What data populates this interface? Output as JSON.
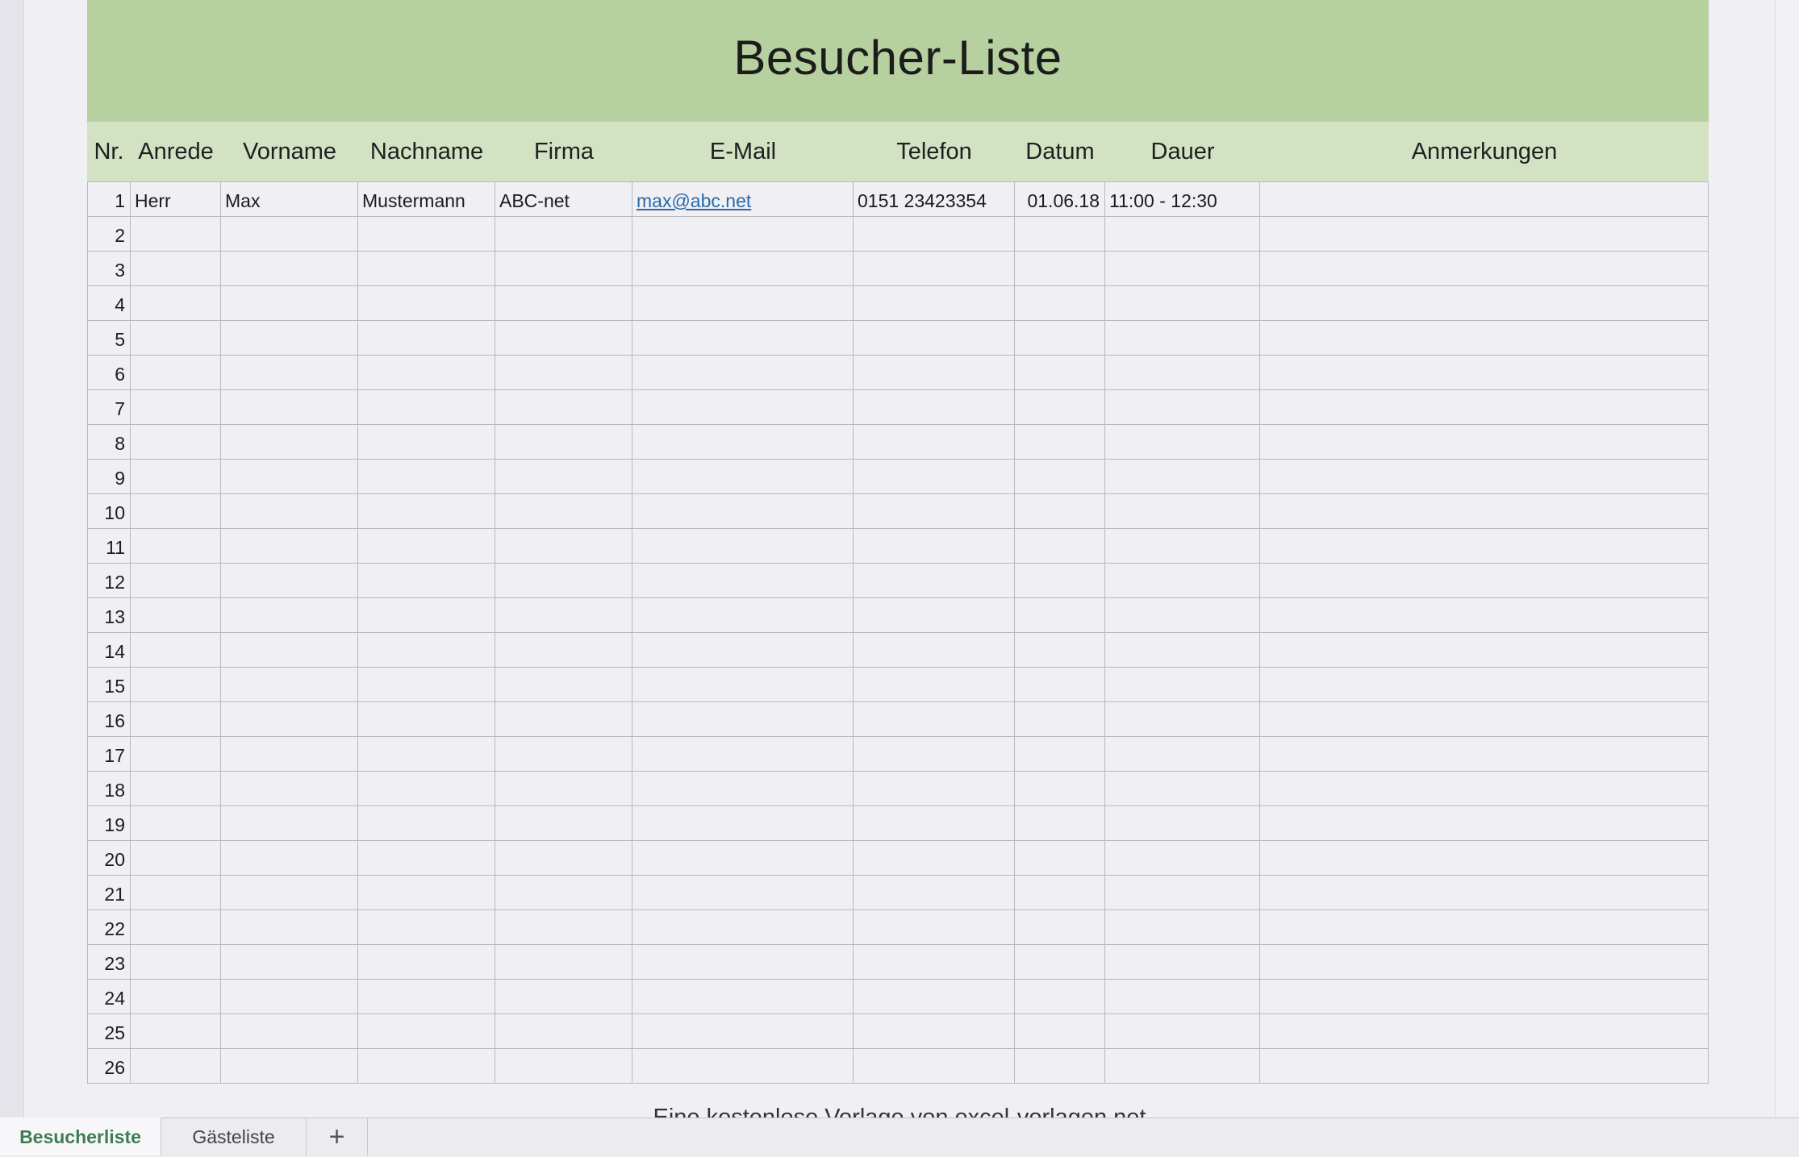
{
  "title": "Besucher-Liste",
  "colors": {
    "title_band": "#b6d0a0",
    "header_band": "#d2e2c3",
    "link": "#2a6aa8",
    "active_tab": "#3f7d50"
  },
  "columns": [
    "Nr.",
    "Anrede",
    "Vorname",
    "Nachname",
    "Firma",
    "E-Mail",
    "Telefon",
    "Datum",
    "Dauer",
    "Anmerkungen"
  ],
  "rows": [
    {
      "nr": "1",
      "anrede": "Herr",
      "vorname": "Max",
      "nachname": "Mustermann",
      "firma": "ABC-net",
      "email": "max@abc.net",
      "telefon": "0151 23423354",
      "datum": "01.06.18",
      "dauer": "11:00 - 12:30",
      "anmerkungen": ""
    },
    {
      "nr": "2"
    },
    {
      "nr": "3"
    },
    {
      "nr": "4"
    },
    {
      "nr": "5"
    },
    {
      "nr": "6"
    },
    {
      "nr": "7"
    },
    {
      "nr": "8"
    },
    {
      "nr": "9"
    },
    {
      "nr": "10"
    },
    {
      "nr": "11"
    },
    {
      "nr": "12"
    },
    {
      "nr": "13"
    },
    {
      "nr": "14"
    },
    {
      "nr": "15"
    },
    {
      "nr": "16"
    },
    {
      "nr": "17"
    },
    {
      "nr": "18"
    },
    {
      "nr": "19"
    },
    {
      "nr": "20"
    },
    {
      "nr": "21"
    },
    {
      "nr": "22"
    },
    {
      "nr": "23"
    },
    {
      "nr": "24"
    },
    {
      "nr": "25"
    },
    {
      "nr": "26"
    }
  ],
  "footer": "Eine kostenlose Vorlage von excel-vorlagen.net",
  "tabs": {
    "active": "Besucherliste",
    "second": "Gästeliste",
    "add_icon": "plus-icon",
    "add_symbol": "+"
  }
}
